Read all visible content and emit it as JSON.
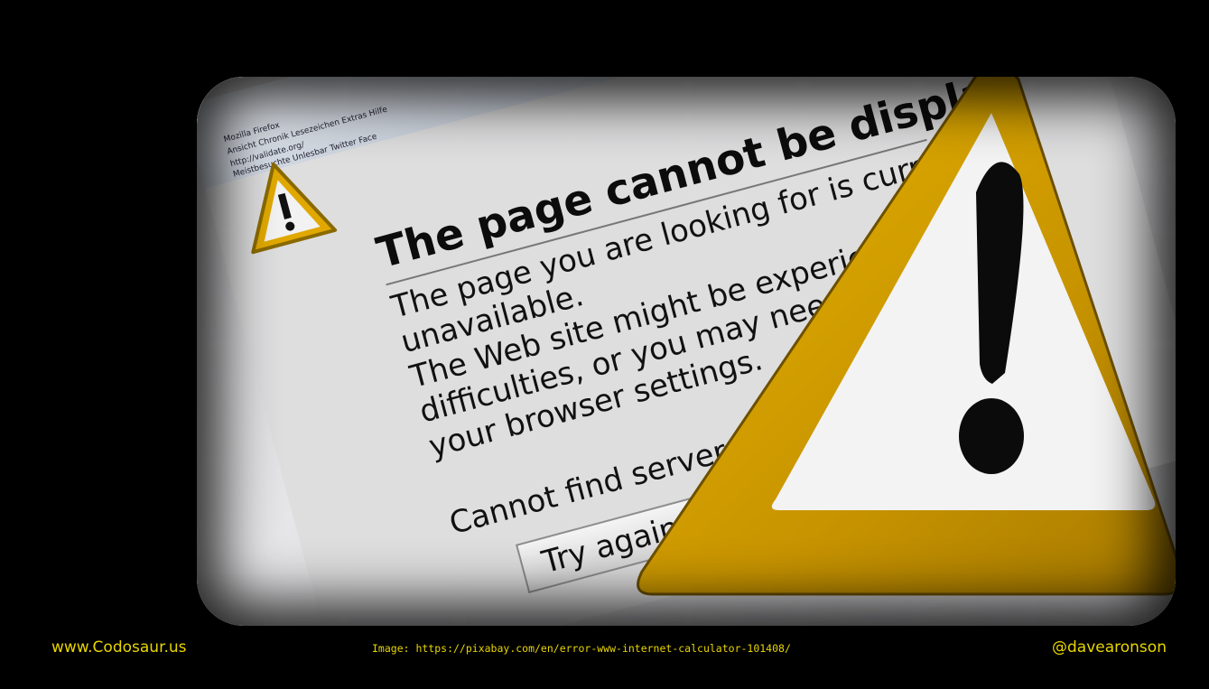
{
  "photo": {
    "browser": {
      "menu_text": "Ansicht  Chronik  Lesezeichen  Extras  Hilfe",
      "url_text": "http://validate.org/",
      "bookmarks_text": "Meistbesuchte  Unlesbar  Twitter  Face",
      "window_title": "Mozilla Firefox"
    },
    "error": {
      "title": "The page cannot be displa",
      "line1": "The page you are looking for is curren",
      "line2": "unavailable.",
      "line3": "The Web site might be experien",
      "line4": "difficulties, or you may need",
      "line5": "your browser settings.",
      "line6": "Cannot find server o",
      "button": "Try again"
    },
    "icons": {
      "small": "warning-triangle-icon",
      "large": "warning-triangle-icon",
      "warning_color": "#d9a400",
      "glyph": "!"
    }
  },
  "footer": {
    "site": "www.Codosaur.us",
    "credit": "Image: https://pixabay.com/en/error-www-internet-calculator-101408/",
    "handle": "@davearonson",
    "color": "#e8d500"
  }
}
